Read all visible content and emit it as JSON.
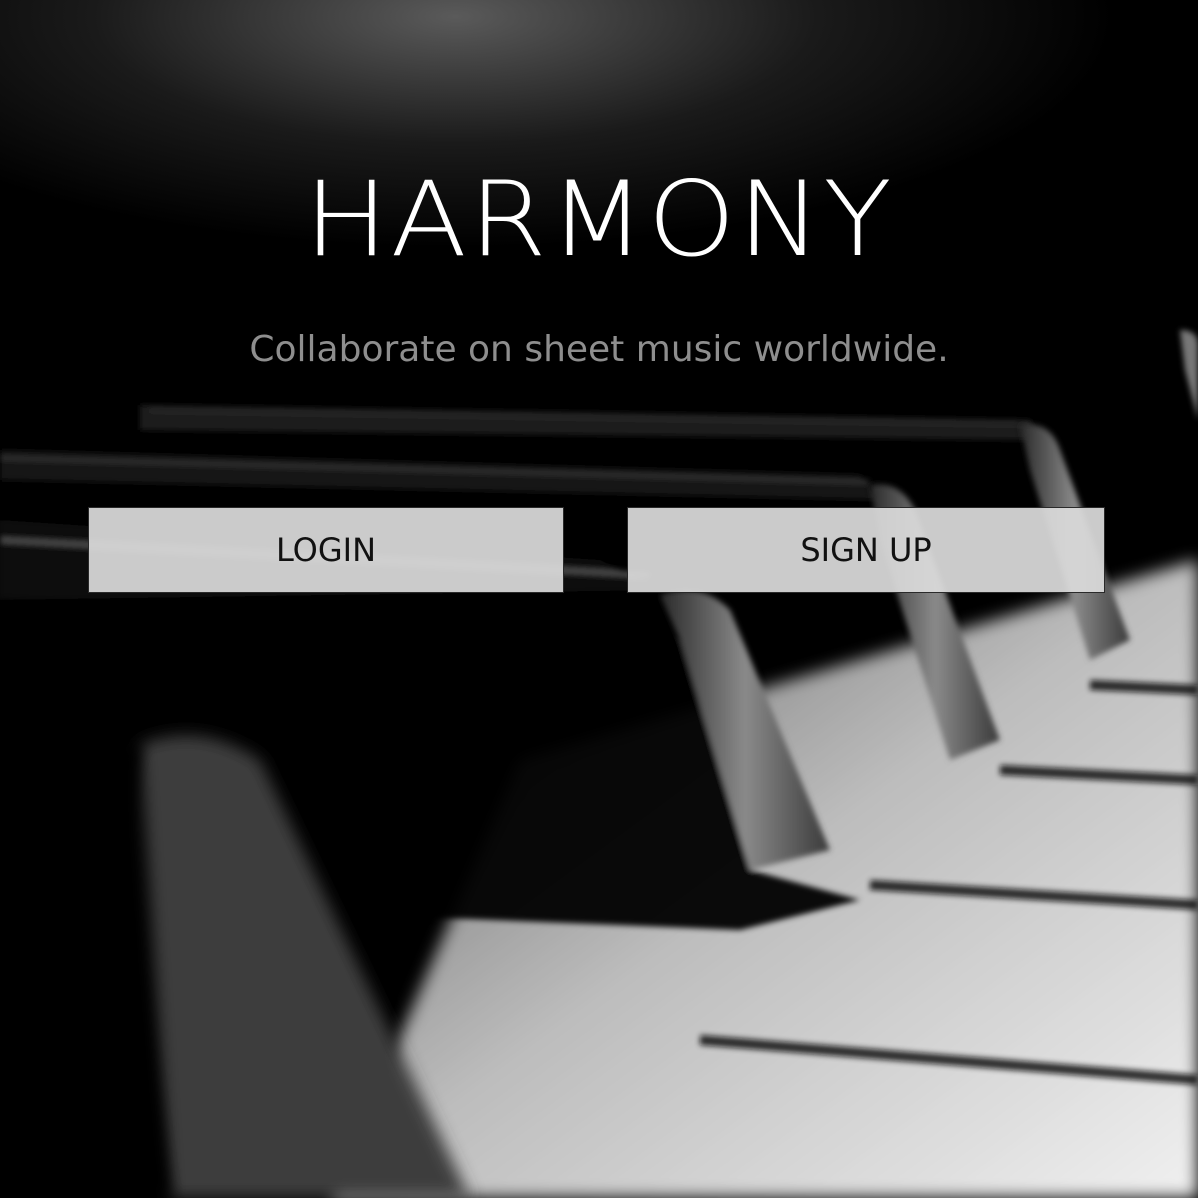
{
  "hero": {
    "title": "HARMONY",
    "tagline": "Collaborate on sheet music worldwide."
  },
  "actions": {
    "login_label": "LOGIN",
    "signup_label": "SIGN UP"
  },
  "colors": {
    "title": "#ffffff",
    "tagline": "#8e8e8e",
    "button_bg": "#dadada",
    "button_text": "#111111"
  }
}
